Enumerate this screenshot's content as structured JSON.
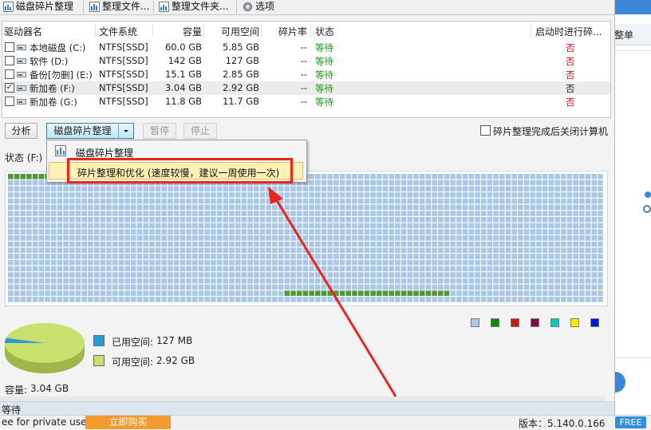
{
  "toolbar": {
    "items": [
      {
        "label": "磁盘碎片整理"
      },
      {
        "label": "整理文件..."
      },
      {
        "label": "整理文件夹..."
      },
      {
        "label": "选项"
      }
    ]
  },
  "drive_table": {
    "headers": [
      "驱动器名",
      "文件系统",
      "容量",
      "可用空间",
      "碎片率",
      "状态",
      "启动时进行碎..."
    ],
    "rows": [
      {
        "checked": false,
        "name": "本地磁盘 (C:)",
        "fs": "NTFS[SSD]",
        "capacity": "60.0 GB",
        "free": "5.85 GB",
        "frag": "--",
        "status": "等待",
        "boot": "否",
        "boot_color": "red"
      },
      {
        "checked": false,
        "name": "软件 (D:)",
        "fs": "NTFS[SSD]",
        "capacity": "142 GB",
        "free": "127 GB",
        "frag": "--",
        "status": "等待",
        "boot": "否",
        "boot_color": "red"
      },
      {
        "checked": false,
        "name": "备份[勿删] (E:)",
        "fs": "NTFS[SSD]",
        "capacity": "15.1 GB",
        "free": "2.85 GB",
        "frag": "--",
        "status": "等待",
        "boot": "否",
        "boot_color": "red"
      },
      {
        "checked": true,
        "name": "新加卷 (F:)",
        "fs": "NTFS[SSD]",
        "capacity": "3.04 GB",
        "free": "2.92 GB",
        "frag": "--",
        "status": "等待",
        "boot": "否",
        "boot_color": "black"
      },
      {
        "checked": false,
        "name": "新加卷 (G:)",
        "fs": "NTFS[SSD]",
        "capacity": "11.8 GB",
        "free": "11.7 GB",
        "frag": "--",
        "status": "等待",
        "boot": "否",
        "boot_color": "red"
      }
    ]
  },
  "actions": {
    "analyze": "分析",
    "defrag": "磁盘碎片整理",
    "pause": "暂停",
    "stop": "停止",
    "shutdown_label": "碎片整理完成后关闭计算机"
  },
  "status_label": "状态 (F:)",
  "dropdown_menu": {
    "items": [
      {
        "label": "磁盘碎片整理"
      },
      {
        "label": "碎片整理和优化 (速度较慢，建议一周使用一次)"
      }
    ]
  },
  "cluster_legend_colors": [
    "#a9c7e6",
    "#0b8a0b",
    "#d01818",
    "#7b0e43",
    "#00c8d2",
    "#ffe800",
    "#0019d8"
  ],
  "usage": {
    "used_label": "已用空间:",
    "used_value": "127 MB",
    "free_label": "可用空间:",
    "free_value": "2.92 GB",
    "capacity_label": "容量:",
    "capacity_value": "3.04 GB",
    "used_fraction": 0.041,
    "used_color": "#2b9ad8",
    "free_color": "#c8e06e"
  },
  "window_status": "等待",
  "bottom_bar": {
    "license": "ee for private use",
    "buy_now": "立即购买",
    "version_label": "版本：",
    "version": "5.140.0.166",
    "free_badge": "FREE"
  },
  "background_app": {
    "dropdown_text": "整单"
  },
  "colors": {
    "annotation_red": "#e8281e",
    "status_green": "#169a16",
    "map_used_green": "#4c9a3c"
  }
}
